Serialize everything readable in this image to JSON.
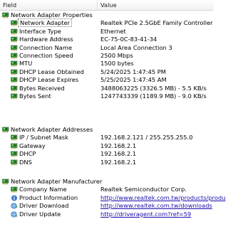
{
  "header": {
    "field_label": "Field",
    "value_label": "Value"
  },
  "groups": [
    {
      "title": "Network Adapter Properties",
      "icon": "network-card-icon",
      "rows": [
        {
          "field": "Network Adapter",
          "value": "Realtek PCIe 2.5GbE Family Controller",
          "icon": "network-card-icon",
          "selected": true
        },
        {
          "field": "Interface Type",
          "value": "Ethernet",
          "icon": "network-card-icon"
        },
        {
          "field": "Hardware Address",
          "value": "EC-75-0C-83-41-34",
          "icon": "network-card-icon"
        },
        {
          "field": "Connection Name",
          "value": "Local Area Connection 3",
          "icon": "network-card-icon"
        },
        {
          "field": "Connection Speed",
          "value": "2500 Mbps",
          "icon": "network-card-icon"
        },
        {
          "field": "MTU",
          "value": "1500 bytes",
          "icon": "network-card-icon"
        },
        {
          "field": "DHCP Lease Obtained",
          "value": "5/24/2025 1:47:45 PM",
          "icon": "network-card-icon"
        },
        {
          "field": "DHCP Lease Expires",
          "value": "5/25/2025 1:47:45 AM",
          "icon": "network-card-icon"
        },
        {
          "field": "Bytes Received",
          "value": "3488063225 (3326.5 MB) - 5.5 KB/s",
          "icon": "network-card-icon"
        },
        {
          "field": "Bytes Sent",
          "value": "1247743339 (1189.9 MB) - 9.0 KB/s",
          "icon": "network-card-icon"
        }
      ]
    },
    {
      "title": "Network Adapter Addresses",
      "icon": "network-card-icon",
      "rows": [
        {
          "field": "IP / Subnet Mask",
          "value": "192.168.2.121 / 255.255.255.0",
          "icon": "network-card-icon"
        },
        {
          "field": "Gateway",
          "value": "192.168.2.1",
          "icon": "network-card-icon"
        },
        {
          "field": "DHCP",
          "value": "192.168.2.1",
          "icon": "network-card-icon"
        },
        {
          "field": "DNS",
          "value": "192.168.2.1",
          "icon": "network-card-icon"
        }
      ]
    },
    {
      "title": "Network Adapter Manufacturer",
      "icon": "network-card-icon",
      "rows": [
        {
          "field": "Company Name",
          "value": "Realtek Semiconductor Corp.",
          "icon": "network-card-icon"
        },
        {
          "field": "Product Information",
          "value": "http://www.realtek.com.tw/products/produ",
          "icon": "info-icon",
          "link": true
        },
        {
          "field": "Driver Download",
          "value": "http://www.realtek.com.tw/downloads",
          "icon": "globe-download-icon",
          "link": true
        },
        {
          "field": "Driver Update",
          "value": "http://driveragent.com?ref=59",
          "icon": "globe-update-icon",
          "link": true
        }
      ]
    }
  ],
  "colors": {
    "link": "#1a0dab",
    "icon_green": "#2e9e2e",
    "icon_dark": "#1f5f1f"
  }
}
